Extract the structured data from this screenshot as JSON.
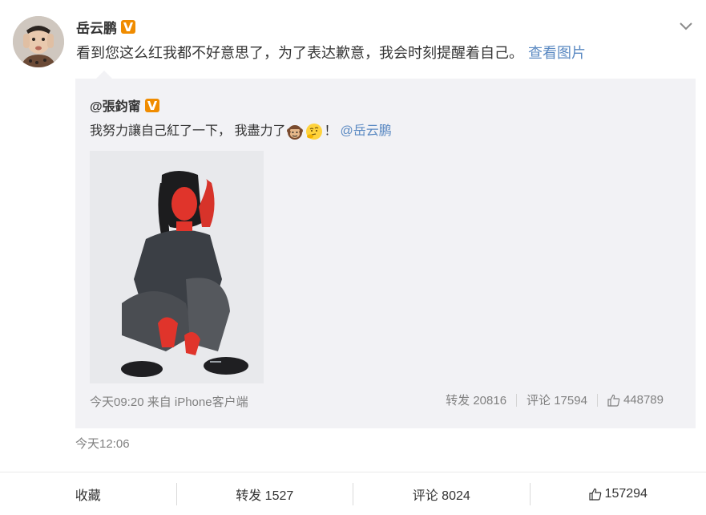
{
  "post": {
    "author": "岳云鹏",
    "text": "看到您这么红我都不好意思了，为了表达歉意，我会时刻提醒着自己。",
    "view_image_link": "查看图片",
    "time": "今天12:06"
  },
  "repost": {
    "author": "@張鈞甯",
    "text_before": "我努力讓自己紅了一下， 我盡力了",
    "text_after": "！",
    "mention": "@岳云鹏",
    "meta": "今天09:20 来自 iPhone客户端",
    "forward": "转发 20816",
    "comment": "评论 17594",
    "likes": "448789"
  },
  "actions": {
    "favorite": "收藏",
    "forward": "转发 1527",
    "comment": "评论 8024",
    "likes": "157294"
  },
  "colors": {
    "link": "#5a89c2",
    "badge": "#f08c00",
    "repost_bg": "#f2f2f5",
    "meta_gray": "#808080"
  },
  "icons": [
    "avatar",
    "verified-badge-icon",
    "chevron-down-icon",
    "monkey-emoji-icon",
    "thinking-emoji-icon",
    "thumbs-up-icon"
  ]
}
